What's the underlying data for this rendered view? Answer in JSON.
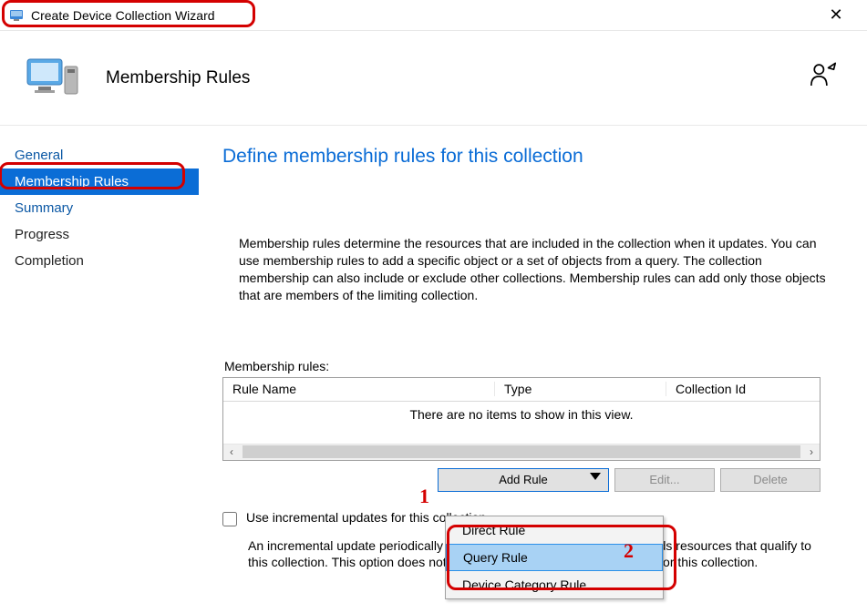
{
  "window": {
    "title": "Create Device Collection Wizard"
  },
  "header": {
    "title": "Membership Rules"
  },
  "sidebar": {
    "items": [
      {
        "label": "General",
        "state": "link"
      },
      {
        "label": "Membership Rules",
        "state": "active"
      },
      {
        "label": "Summary",
        "state": "link"
      },
      {
        "label": "Progress",
        "state": "normal"
      },
      {
        "label": "Completion",
        "state": "normal"
      }
    ]
  },
  "main": {
    "heading": "Define membership rules for this collection",
    "description": "Membership rules determine the resources that are included in the collection when it updates. You can use membership rules to add a specific object or a set of objects from a query. The collection membership can also include or exclude other collections. Membership rules can add only those objects that are members of the limiting collection.",
    "rules_label": "Membership rules:",
    "columns": {
      "c1": "Rule Name",
      "c2": "Type",
      "c3": "Collection Id"
    },
    "empty_text": "There are no items to show in this view.",
    "buttons": {
      "add_rule": "Add Rule",
      "edit": "Edit...",
      "delete": "Delete"
    },
    "menu": {
      "items": [
        {
          "label": "Direct Rule",
          "selected": false
        },
        {
          "label": "Query Rule",
          "selected": true
        },
        {
          "label": "Device Category Rule",
          "selected": false
        }
      ]
    },
    "checkbox_label": "Use incremental updates for this collection",
    "incremental_desc": "An incremental update periodically evaluates new resources and then adds resources that qualify to this collection. This option does not require you to schedule a full update for this collection."
  },
  "annotations": {
    "num1": "1",
    "num2": "2"
  }
}
